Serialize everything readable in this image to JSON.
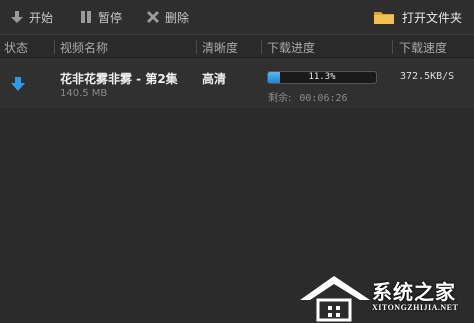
{
  "toolbar": {
    "start_label": "开始",
    "pause_label": "暂停",
    "delete_label": "删除",
    "open_folder_label": "打开文件夹"
  },
  "columns": {
    "status": "状态",
    "name": "视频名称",
    "quality": "清晰度",
    "progress": "下载进度",
    "speed": "下载速度"
  },
  "downloads": [
    {
      "title": "花非花雾非雾 - 第2集",
      "size": "140.5 MB",
      "quality": "高清",
      "progress_text": "11.3%",
      "progress_value": 0.113,
      "remaining_label": "剩余:",
      "remaining_time": "00:06:26",
      "speed": "372.5KB/S",
      "status_icon": "download-arrow-icon"
    }
  ],
  "watermark": {
    "brand": "系统之家",
    "url": "XITONGZHIJIA.NET"
  },
  "colors": {
    "accent": "#2d9ae6",
    "background": "#2b2b2b",
    "folder": "#f2c24f"
  }
}
